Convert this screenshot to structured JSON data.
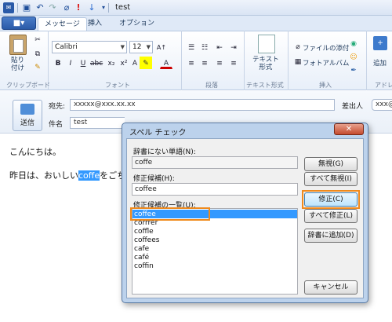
{
  "window": {
    "title": "test"
  },
  "tabs": {
    "file": "■▾",
    "message": "メッセージ",
    "insert": "挿入",
    "options": "オプション"
  },
  "ribbon": {
    "paste": "貼り\n付け",
    "clipboard_group": "クリップボード",
    "font_name": "Calibri",
    "font_size": "12",
    "font_group": "フォント",
    "paragraph_group": "段落",
    "text_format_label": "テキスト\n形式",
    "text_format_group": "テキスト形式",
    "attach_file": "ファイルの添付",
    "photo_album": "フォトアルバム",
    "insert_group": "挿入",
    "add_label": "追加",
    "address_group": "アドレ"
  },
  "compose": {
    "send": "送信",
    "to_label": "宛先:",
    "to_value": "xxxxx@xxx.xx.xx",
    "from_label": "差出人",
    "from_value": "xxx@",
    "subject_label": "件名",
    "subject_value": "test",
    "line1": "こんにちは。",
    "line2_before": "昨日は、おいしい",
    "line2_word": "coffe",
    "line2_after": "をごち"
  },
  "dialog": {
    "title": "スペル チェック",
    "close": "✕",
    "not_in_dict_label": "辞書にない単語(N):",
    "not_in_dict_value": "coffe",
    "change_to_label": "修正候補(H):",
    "change_to_value": "coffee",
    "suggestions_label": "修正候補の一覧(U):",
    "suggestions": [
      "coffee",
      "corrrer",
      "coffle",
      "coffees",
      "cafe",
      "café",
      "coffin"
    ],
    "buttons": {
      "ignore": "無視(G)",
      "ignore_all": "すべて無視(I)",
      "change": "修正(C)",
      "change_all": "すべて修正(L)",
      "add_to_dict": "辞書に追加(D)",
      "cancel": "キャンセル"
    }
  },
  "colors": {
    "highlight": "#3399ff",
    "callout": "#f08a1c",
    "selected_item": "#3399ff"
  }
}
